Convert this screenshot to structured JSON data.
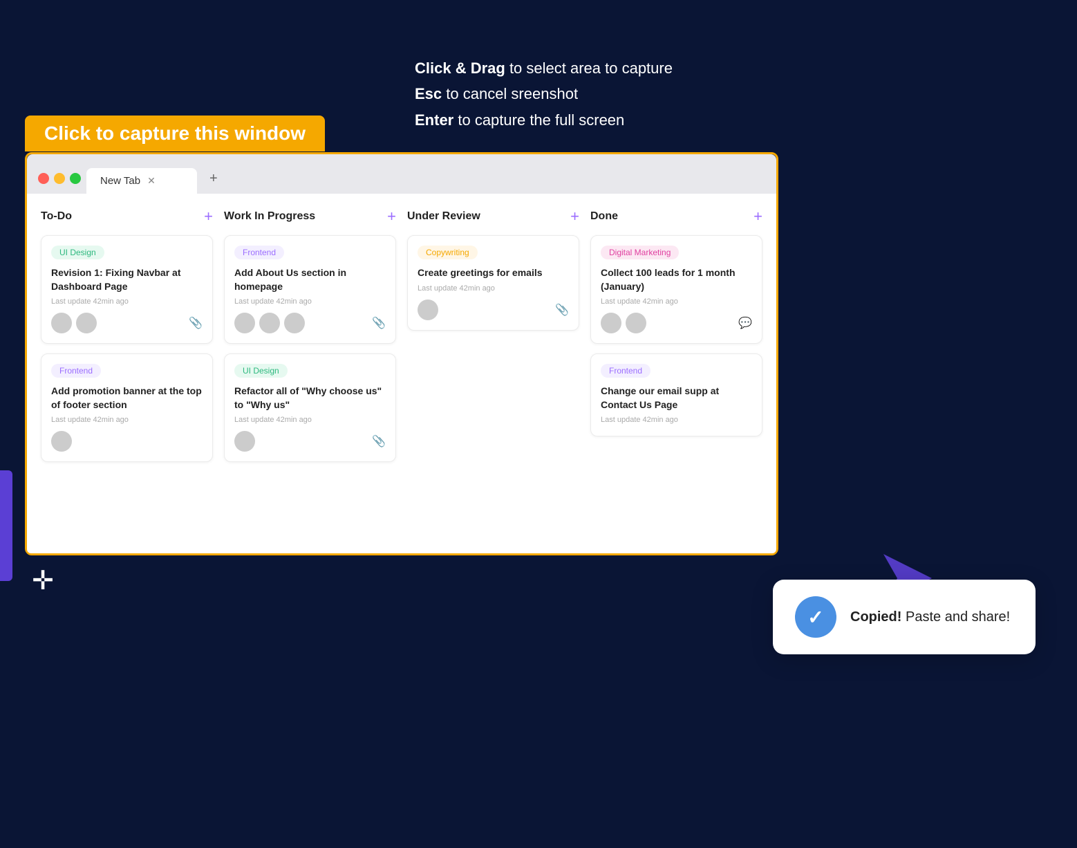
{
  "instructions": {
    "line1_bold": "Click & Drag",
    "line1_rest": " to select area to capture",
    "line2_bold": "Esc",
    "line2_rest": " to cancel sreenshot",
    "line3_bold": "Enter",
    "line3_rest": " to capture the full screen"
  },
  "capture_label": "Click to capture this window",
  "browser": {
    "tab_title": "New Tab",
    "tab_close": "✕",
    "tab_new": "+"
  },
  "columns": [
    {
      "id": "todo",
      "title": "To-Do",
      "cards": [
        {
          "tag": "UI Design",
          "tag_class": "tag-ui-design",
          "title": "Revision 1: Fixing Navbar at Dashboard Page",
          "meta": "Last update 42min ago",
          "avatars": 2,
          "icon": "📎"
        },
        {
          "tag": "Frontend",
          "tag_class": "tag-frontend",
          "title": "Add promotion banner at the top of footer section",
          "meta": "Last update 42min ago",
          "avatars": 1,
          "icon": ""
        }
      ]
    },
    {
      "id": "wip",
      "title": "Work In Progress",
      "cards": [
        {
          "tag": "Frontend",
          "tag_class": "tag-frontend",
          "title": "Add About Us section in homepage",
          "meta": "Last update 42min ago",
          "avatars": 3,
          "icon": "📎"
        },
        {
          "tag": "UI Design",
          "tag_class": "tag-ui-design",
          "title": "Refactor all of \"Why choose us\" to \"Why us\"",
          "meta": "Last update 42min ago",
          "avatars": 1,
          "icon": "📎"
        }
      ]
    },
    {
      "id": "review",
      "title": "Under Review",
      "cards": [
        {
          "tag": "Copywriting",
          "tag_class": "tag-copywriting",
          "title": "Create greetings for emails",
          "meta": "Last update 42min ago",
          "avatars": 1,
          "icon": "📎"
        }
      ]
    },
    {
      "id": "done",
      "title": "Done",
      "cards": [
        {
          "tag": "Digital Marketing",
          "tag_class": "tag-digital-marketing",
          "title": "Collect 100 leads for 1 month (January)",
          "meta": "Last update 42min ago",
          "avatars": 2,
          "icon": "💬"
        },
        {
          "tag": "Frontend",
          "tag_class": "tag-frontend",
          "title": "Change our email supp at Contact Us Page",
          "meta": "Last update 42min ago",
          "avatars": 0,
          "icon": ""
        }
      ]
    }
  ],
  "copied_notification": {
    "bold": "Copied!",
    "text": " Paste and share!"
  }
}
